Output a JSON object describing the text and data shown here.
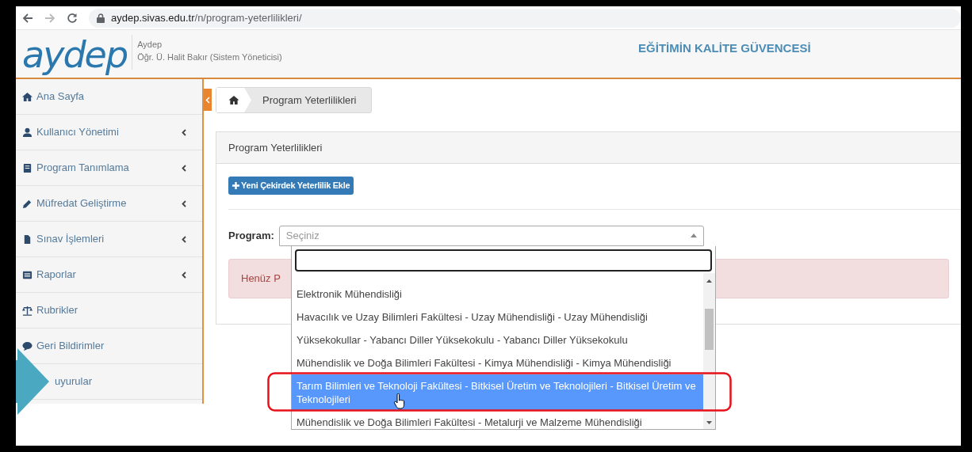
{
  "browser": {
    "url_host": "aydep.sivas.edu.tr",
    "url_path": "/n/program-yeterlilikleri/"
  },
  "header": {
    "logo": "aydep",
    "app_name": "Aydep",
    "user": "Öğr. Ü. Halit Bakır (Sistem Yöneticisi)",
    "tagline": "EĞİTİMİN KALİTE GÜVENCESİ"
  },
  "sidebar": {
    "items": [
      {
        "label": "Ana Sayfa",
        "has_submenu": false
      },
      {
        "label": "Kullanıcı Yönetimi",
        "has_submenu": true
      },
      {
        "label": "Program Tanımlama",
        "has_submenu": true
      },
      {
        "label": "Müfredat Geliştirme",
        "has_submenu": true
      },
      {
        "label": "Sınav İşlemleri",
        "has_submenu": true
      },
      {
        "label": "Raporlar",
        "has_submenu": true
      },
      {
        "label": "Rubrikler",
        "has_submenu": false
      },
      {
        "label": "Geri Bildirimler",
        "has_submenu": false
      },
      {
        "label": "uyurular",
        "has_submenu": false
      }
    ]
  },
  "breadcrumb": {
    "items": [
      "Program Yeterlilikleri"
    ]
  },
  "panel": {
    "title": "Program Yeterlilikleri",
    "add_button": "Yeni Çekirdek Yeterlilik Ekle",
    "program_select": {
      "label": "Program:",
      "placeholder": "Seçiniz",
      "expanded": true,
      "options": [
        {
          "label": "Elektronik Mühendisliği",
          "selected": false
        },
        {
          "label": "Havacılık ve Uzay Bilimleri Fakültesi - Uzay Mühendisliği - Uzay Mühendisliği",
          "selected": false
        },
        {
          "label": "Yüksekokullar - Yabancı Diller Yüksekokulu - Yabancı Diller Yüksekokulu",
          "selected": false
        },
        {
          "label": "Mühendislik ve Doğa Bilimleri Fakültesi - Kimya Mühendisliği - Kimya Mühendisliği",
          "selected": false
        },
        {
          "label": "Tarım Bilimleri ve Teknoloji Fakültesi - Bitkisel Üretim ve Teknolojileri - Bitkisel Üretim ve Teknolojileri",
          "selected": true
        },
        {
          "label": "Mühendislik ve Doğa Bilimleri Fakültesi - Metalurji ve Malzeme Mühendisliği",
          "selected": false
        }
      ]
    },
    "alert": "Henüz P"
  }
}
